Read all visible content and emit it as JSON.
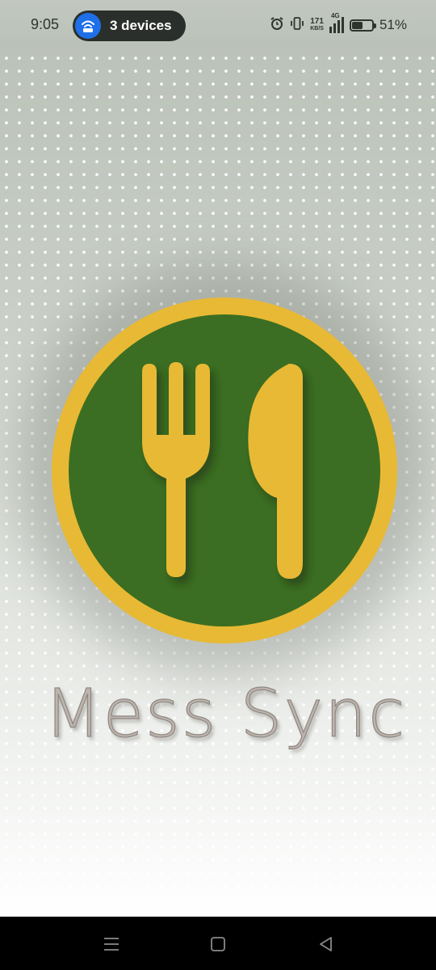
{
  "status_bar": {
    "time": "9:05",
    "hotspot_label": "3 devices",
    "net_speed_value": "171",
    "net_speed_unit": "KB/S",
    "network_type": "4G",
    "battery_percent": "51%",
    "battery_level": 0.51,
    "icons": [
      "alarm-icon",
      "vibrate-icon",
      "signal-icon",
      "battery-icon"
    ]
  },
  "logo": {
    "icon": "fork-and-knife-icon",
    "colors": {
      "ring": "#e8b934",
      "disc": "#3b6e22",
      "utensils": "#e8b934"
    }
  },
  "app_name": "Mess Sync",
  "nav_bar": {
    "buttons": [
      "menu-icon",
      "home-icon",
      "back-icon"
    ]
  }
}
